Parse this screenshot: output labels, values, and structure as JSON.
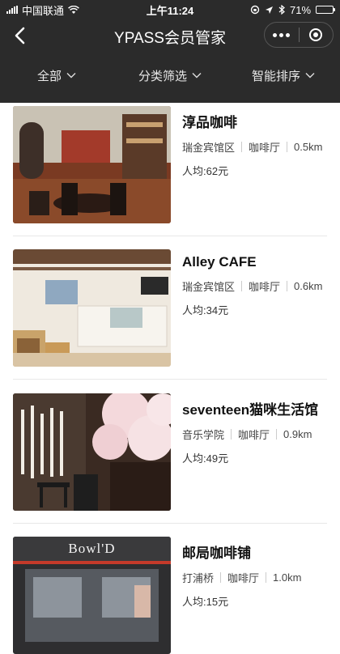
{
  "status": {
    "carrier": "中国联通",
    "time": "上午11:24",
    "battery": "71%",
    "battery_level": 0.71
  },
  "nav": {
    "title": "YPASS会员管家"
  },
  "filters": [
    {
      "label": "全部"
    },
    {
      "label": "分类筛选"
    },
    {
      "label": "智能排序"
    }
  ],
  "items": [
    {
      "name": "淳品咖啡",
      "area": "瑞金宾馆区",
      "category": "咖啡厅",
      "distance": "0.5km",
      "price": "人均:62元"
    },
    {
      "name": "Alley CAFE",
      "area": "瑞金宾馆区",
      "category": "咖啡厅",
      "distance": "0.6km",
      "price": "人均:34元"
    },
    {
      "name": "seventeen猫咪生活馆",
      "area": "音乐学院",
      "category": "咖啡厅",
      "distance": "0.9km",
      "price": "人均:49元"
    },
    {
      "name": "邮局咖啡铺",
      "area": "打浦桥",
      "category": "咖啡厅",
      "distance": "1.0km",
      "price": "人均:15元",
      "sign_text": "Bowl'D"
    }
  ],
  "icons": {
    "back": "back-arrow-icon",
    "more": "more-dots-icon",
    "close": "close-ring-icon",
    "chevron": "chevron-down-icon"
  },
  "colors": {
    "header_bg": "#2b2b2b",
    "divider": "#e8e8e8"
  }
}
